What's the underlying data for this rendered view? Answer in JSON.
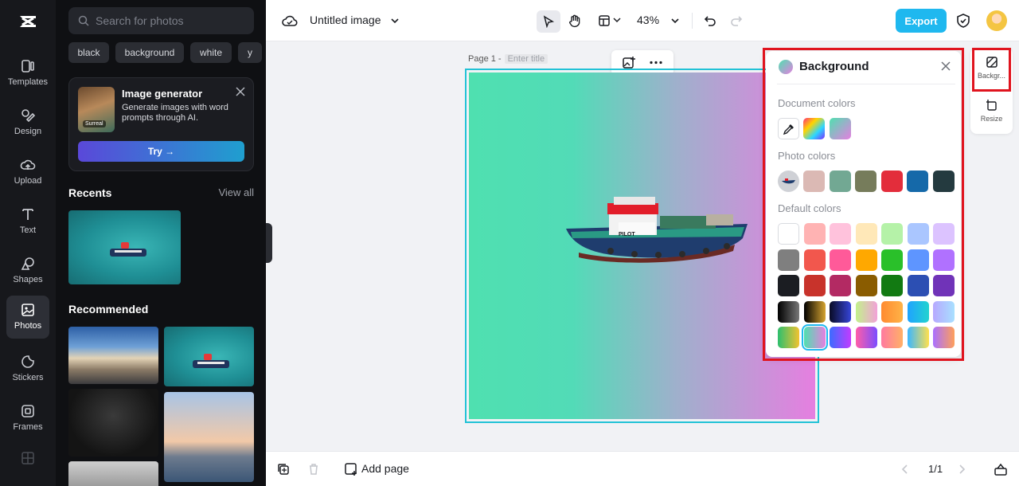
{
  "app": {
    "title": "Untitled image",
    "zoom": "43%",
    "export_label": "Export"
  },
  "rail": {
    "items": [
      {
        "label": "Templates",
        "icon": "templates-icon"
      },
      {
        "label": "Design",
        "icon": "design-icon"
      },
      {
        "label": "Upload",
        "icon": "upload-icon"
      },
      {
        "label": "Text",
        "icon": "text-icon"
      },
      {
        "label": "Shapes",
        "icon": "shapes-icon"
      },
      {
        "label": "Photos",
        "icon": "photos-icon"
      },
      {
        "label": "Stickers",
        "icon": "stickers-icon"
      },
      {
        "label": "Frames",
        "icon": "frames-icon"
      }
    ],
    "active": "Photos"
  },
  "panel": {
    "search_placeholder": "Search for photos",
    "chips": [
      "black",
      "background",
      "white",
      "y"
    ],
    "promo": {
      "title": "Image generator",
      "description": "Generate images with word prompts through AI.",
      "thumb_tag": "Surreal",
      "try_label": "Try →"
    },
    "recents_title": "Recents",
    "view_all": "View all",
    "recommended_title": "Recommended"
  },
  "canvas": {
    "page_label": "Page 1 -",
    "title_placeholder": "Enter title",
    "gradient": [
      "#4fe0b0",
      "#e57fe0"
    ],
    "boat_text": "PILOT"
  },
  "bottom": {
    "add_page": "Add page",
    "page_indicator": "1/1"
  },
  "right_rail": {
    "background_label": "Backgr...",
    "resize_label": "Resize"
  },
  "background_panel": {
    "title": "Background",
    "document_colors_label": "Document colors",
    "photo_colors_label": "Photo colors",
    "default_colors_label": "Default colors",
    "document_colors": [
      "linear-gradient(135deg,#ff2f7a,#ffd400,#2cd6ff,#7b2cff)",
      "linear-gradient(135deg,#4fe0b0,#e57fe0)"
    ],
    "photo_colors": [
      "#dbb9b4",
      "#72a893",
      "#767c5b",
      "#e32d3b",
      "#1569a9",
      "#243a3f"
    ],
    "default_colors": [
      [
        "#ffffff",
        "#ffb3b3",
        "#ffc2dc",
        "#ffe8b8",
        "#b5f2a8",
        "#aac6ff",
        "#dcc3ff"
      ],
      [
        "#7f7f7f",
        "#f2574d",
        "#ff5a99",
        "#ffa800",
        "#2ac02a",
        "#5e95ff",
        "#b071ff"
      ],
      [
        "#1b1d22",
        "#c8332b",
        "#b32a63",
        "#8a5c00",
        "#127a12",
        "#2c4fb3",
        "#7033b8"
      ],
      [
        "linear-gradient(90deg,#000,#777)",
        "linear-gradient(90deg,#000,#d6a431)",
        "linear-gradient(90deg,#090b24,#3645d8)",
        "linear-gradient(90deg,#c2f28a,#f2a1d8)",
        "linear-gradient(90deg,#ff8a30,#ffb347)",
        "linear-gradient(90deg,#1fa3ff,#22d3cf)",
        "linear-gradient(90deg,#b7a8ff,#a8e0ff)"
      ],
      [
        "linear-gradient(90deg,#2dbf6e,#f2c230)",
        "linear-gradient(90deg,#4fe0b0,#e57fe0)",
        "linear-gradient(90deg,#3b6cff,#c23bff)",
        "linear-gradient(90deg,#ff5ea8,#7b4dff)",
        "linear-gradient(90deg,#ff7aa0,#ffb067)",
        "linear-gradient(90deg,#3bb7ff,#ffe04d)",
        "linear-gradient(90deg,#a970ff,#ff9f5a)"
      ]
    ]
  }
}
